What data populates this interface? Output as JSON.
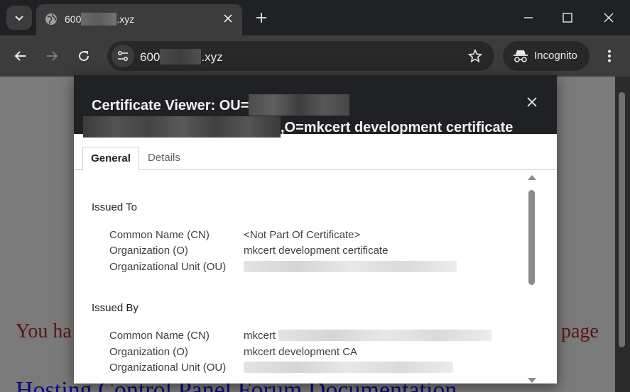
{
  "browser": {
    "tab_title_prefix": "600",
    "tab_title_suffix": ".xyz",
    "url_prefix": "600",
    "url_suffix": ".xyz",
    "incognito_label": "Incognito"
  },
  "page_background": {
    "text_left": "You ha",
    "text_right": "page",
    "heading_fragment": "Hosting Control Panel Forum Documentation"
  },
  "dialog": {
    "title_line1": "Certificate Viewer: OU=",
    "title_line2_suffix": ",O=mkcert development certificate",
    "tabs": [
      "General",
      "Details"
    ],
    "issued_to": {
      "heading": "Issued To",
      "rows": [
        {
          "label": "Common Name (CN)",
          "value": "<Not Part Of Certificate>"
        },
        {
          "label": "Organization (O)",
          "value": "mkcert development certificate"
        },
        {
          "label": "Organizational Unit (OU)",
          "value": ""
        }
      ]
    },
    "issued_by": {
      "heading": "Issued By",
      "rows": [
        {
          "label": "Common Name (CN)",
          "value": "mkcert"
        },
        {
          "label": "Organization (O)",
          "value": "mkcert development CA"
        },
        {
          "label": "Organizational Unit (OU)",
          "value": ""
        }
      ]
    }
  },
  "colors": {
    "chrome_dark": "#202124",
    "toolbar": "#3c3c3c",
    "page_overlay": "#7b7a7a"
  }
}
